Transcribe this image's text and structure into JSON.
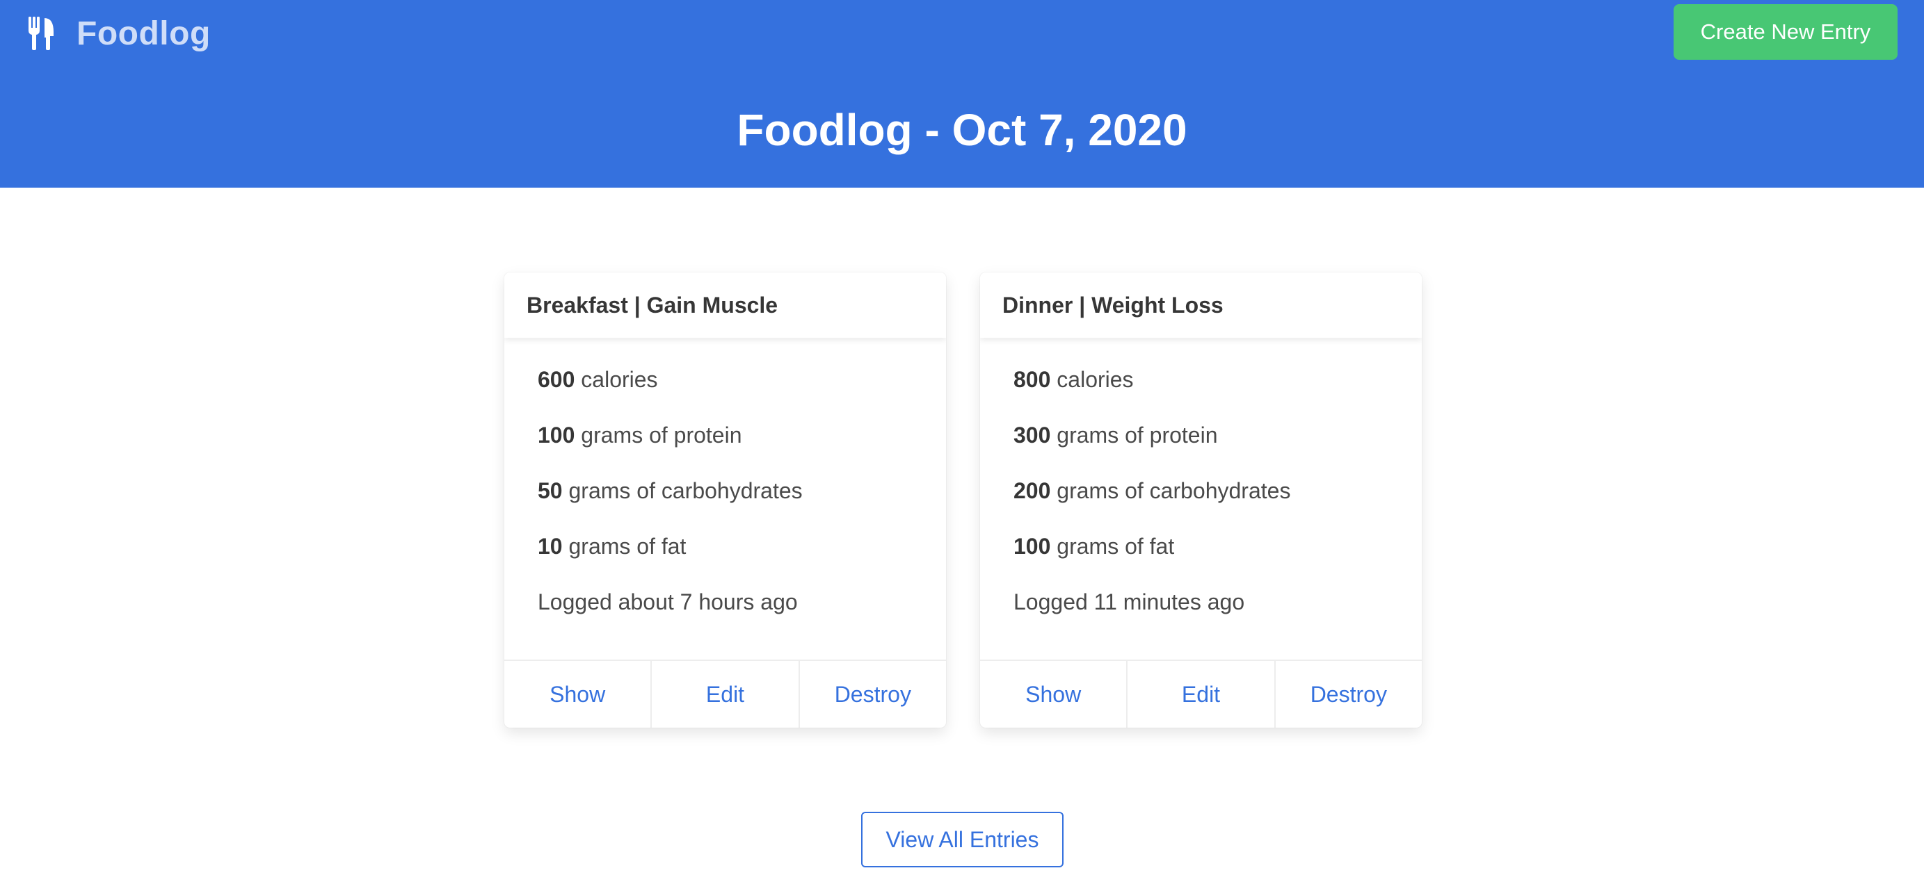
{
  "navbar": {
    "brand_icon": "utensils-icon",
    "brand_name": "Foodlog",
    "create_button_label": "Create New Entry"
  },
  "hero": {
    "title": "Foodlog - Oct 7, 2020"
  },
  "entries": [
    {
      "title": "Breakfast | Gain Muscle",
      "calories_value": "600",
      "calories_label": "calories",
      "protein_value": "100",
      "protein_label": "grams of protein",
      "carbs_value": "50",
      "carbs_label": "grams of carbohydrates",
      "fat_value": "10",
      "fat_label": "grams of fat",
      "logged": "Logged about 7 hours ago",
      "actions": {
        "show": "Show",
        "edit": "Edit",
        "destroy": "Destroy"
      }
    },
    {
      "title": "Dinner | Weight Loss",
      "calories_value": "800",
      "calories_label": "calories",
      "protein_value": "300",
      "protein_label": "grams of protein",
      "carbs_value": "200",
      "carbs_label": "grams of carbohydrates",
      "fat_value": "100",
      "fat_label": "grams of fat",
      "logged": "Logged 11 minutes ago",
      "actions": {
        "show": "Show",
        "edit": "Edit",
        "destroy": "Destroy"
      }
    }
  ],
  "footer": {
    "view_all_label": "View All Entries"
  },
  "colors": {
    "primary": "#3571DE",
    "success": "#48C774",
    "brand_text": "#CFDDF8",
    "text": "#363636"
  }
}
